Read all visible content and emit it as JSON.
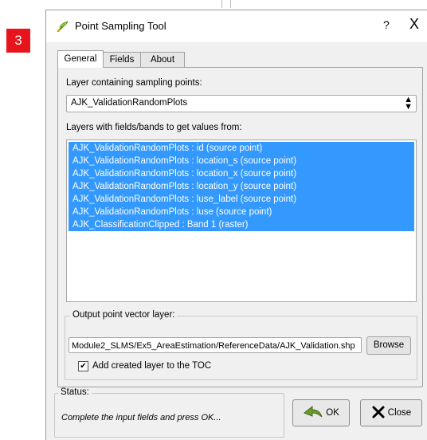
{
  "step_badge": "3",
  "window": {
    "title": "Point Sampling Tool",
    "help_label": "?",
    "close_label": "X"
  },
  "tabs": [
    {
      "label": "General",
      "active": true
    },
    {
      "label": "Fields",
      "active": false
    },
    {
      "label": "About",
      "active": false
    }
  ],
  "general": {
    "sampling_layer_label": "Layer containing sampling points:",
    "sampling_layer_value": "AJK_ValidationRandomPlots",
    "fields_label": "Layers with fields/bands to get values from:",
    "fields": [
      "AJK_ValidationRandomPlots : id (source point)",
      "AJK_ValidationRandomPlots : location_s (source point)",
      "AJK_ValidationRandomPlots : location_x (source point)",
      "AJK_ValidationRandomPlots : location_y (source point)",
      "AJK_ValidationRandomPlots : luse_label (source point)",
      "AJK_ValidationRandomPlots : luse (source point)",
      "AJK_ClassificationClipped : Band 1 (raster)"
    ],
    "output_group_label": "Output point vector layer:",
    "output_path": "Module2_SLMS/Ex5_AreaEstimation/ReferenceData/AJK_Validation.shp",
    "browse_label": "Browse",
    "add_to_toc_label": "Add created layer to the TOC",
    "add_to_toc_checked": true
  },
  "status": {
    "label": "Status:",
    "message": "Complete the input fields and press OK..."
  },
  "buttons": {
    "ok_label": "OK",
    "close_label": "Close"
  },
  "colors": {
    "badge": "#e8141b",
    "selection": "#3399ff"
  }
}
